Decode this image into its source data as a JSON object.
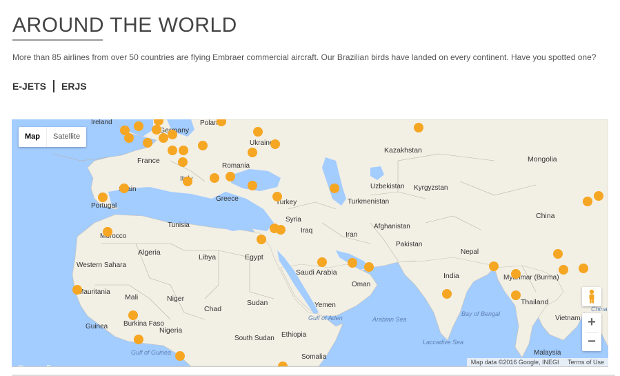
{
  "header": {
    "title": "AROUND THE WORLD",
    "description": "More than 85 airlines from over 50 countries are flying Embraer commercial aircraft. Our Brazilian birds have landed on every continent. Have you spotted one?"
  },
  "tabs": [
    {
      "label": "E-JETS"
    },
    {
      "label": "ERJS"
    }
  ],
  "map": {
    "type_control": {
      "map_label": "Map",
      "satellite_label": "Satellite",
      "selected": "Map"
    },
    "zoom_in_label": "+",
    "zoom_out_label": "−",
    "attribution": "Map data ©2016 Google, INEGI",
    "terms_label": "Terms of Use",
    "logo_text": "Google",
    "logo_colors": [
      "#4285F4",
      "#EA4335",
      "#FBBC05",
      "#4285F4",
      "#34A853",
      "#EA4335"
    ],
    "pin_color": "#F5A623",
    "labels": {
      "countries": [
        "Ireland",
        "Germany",
        "Poland",
        "Ukraine",
        "Kazakhstan",
        "Mongolia",
        "France",
        "Romania",
        "Italy",
        "Spain",
        "Portugal",
        "Greece",
        "Turkey",
        "Uzbekistan",
        "Kyrgyzstan",
        "Turkmenistan",
        "China",
        "Syria",
        "Iraq",
        "Afghanistan",
        "Iran",
        "Pakistan",
        "Tunisia",
        "Morocco",
        "Algeria",
        "Libya",
        "Egypt",
        "Western Sahara",
        "Nepal",
        "India",
        "Saudi Arabia",
        "Oman",
        "Myanmar (Burma)",
        "Mauritania",
        "Mali",
        "Niger",
        "Chad",
        "Sudan",
        "Yemen",
        "Thailand",
        "Vietnam",
        "Burkina Faso",
        "Guinea",
        "Nigeria",
        "South Sudan",
        "Ethiopia",
        "Somalia",
        "Malaysia"
      ],
      "seas": [
        "Gulf of Aden",
        "Arabian Sea",
        "Bay of Bengal",
        "China Sea",
        "Laccadive Sea",
        "Gulf of Guinea"
      ]
    }
  }
}
